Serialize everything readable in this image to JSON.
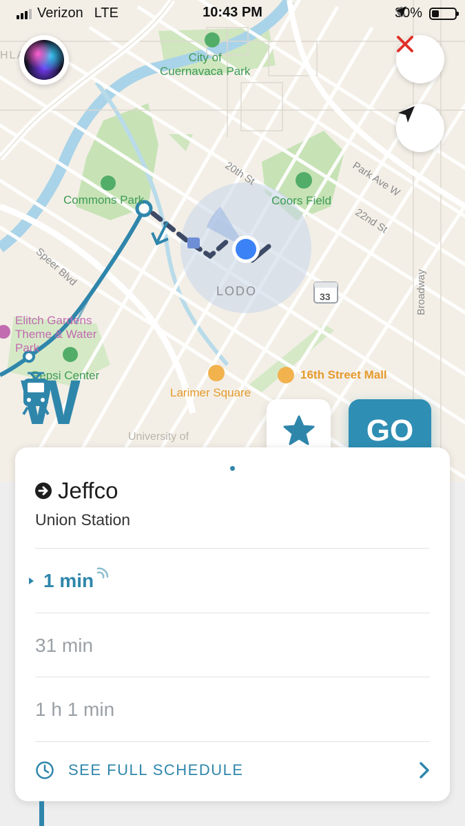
{
  "status_bar": {
    "carrier": "Verizon",
    "network": "LTE",
    "time": "10:43 PM",
    "battery": "30%",
    "battery_level": 0.3
  },
  "map": {
    "labels": {
      "city_of_cuernavaca_park": "City of\nCuernavaca Park",
      "commons_park": "Commons Park",
      "coors_field": "Coors Field",
      "street_20th": "20th St",
      "park_ave_w": "Park Ave W",
      "street_22nd": "22nd St",
      "speer_blvd": "Speer Blvd",
      "broadway": "Broadway",
      "lodo": "LODO",
      "elitch": "Elitch Gardens\nTheme & Water\nPark",
      "pepsi_center": "Pepsi Center",
      "larimer_square": "Larimer Square",
      "sixteenth_street_mall": "16th Street Mall",
      "university": "University of",
      "route_shield": "33",
      "corner_text": "HLA"
    },
    "line_letter": "W"
  },
  "actions": {
    "go_label": "GO"
  },
  "card": {
    "destination": "Jeffco",
    "stop": "Union Station",
    "times": [
      "1 min",
      "31 min",
      "1 h 1 min"
    ],
    "see_schedule": "SEE FULL SCHEDULE"
  },
  "colors": {
    "accent": "#2f86ab",
    "go_button": "#2f8eb3",
    "close_x": "#e0322a",
    "user_location": "#3b82f6"
  },
  "icons": {
    "close": "close-icon",
    "locate": "location-arrow-icon",
    "favorite": "star-icon",
    "train": "light-rail-train-icon",
    "direction": "arrow-right-circle-icon",
    "realtime": "realtime-signal-icon",
    "clock": "clock-icon",
    "chevron": "chevron-right-icon"
  }
}
